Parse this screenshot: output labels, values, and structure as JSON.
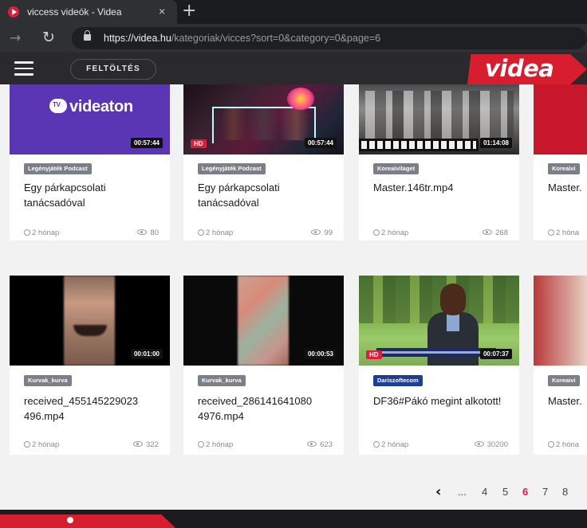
{
  "browser": {
    "tab_title": "viccess videók - Videa",
    "tab_close": "×",
    "new_tab": "+",
    "url_host": "https://videa.hu",
    "url_path": "/kategoriak/vicces?sort=0&category=0&page=6"
  },
  "header": {
    "upload_label": "FELTÖLTÉS",
    "logo_text": "videa"
  },
  "row1": [
    {
      "thumb_text": "videaton",
      "duration": "00:57:44",
      "hd": "",
      "badge": "Legényjáték Podcast",
      "title": "Egy párkapcsolati tanácsadóval",
      "age": "2 hónap",
      "views": "80"
    },
    {
      "thumb_text": "",
      "duration": "00:57:44",
      "hd": "HD",
      "badge": "Legényjáték Podcast",
      "title": "Egy párkapcsolati tanácsadóval",
      "age": "2 hónap",
      "views": "99"
    },
    {
      "thumb_text": "",
      "duration": "01:14:08",
      "hd": "",
      "badge": "Koreaivilaget",
      "title": "Master.146tr.mp4",
      "age": "2 hónap",
      "views": "268"
    },
    {
      "thumb_text": "",
      "duration": "",
      "hd": "",
      "badge": "Koreaivi",
      "title": "Master.",
      "age": "2 hóna",
      "views": ""
    }
  ],
  "row2": [
    {
      "duration": "00:01:00",
      "hd": "",
      "badge": "Kurvak_kurva",
      "title": "received_455145229023 496.mp4",
      "age": "2 hónap",
      "views": "322"
    },
    {
      "duration": "00:00:53",
      "hd": "",
      "badge": "Kurvak_kurva",
      "title": "received_286141641080 4976.mp4",
      "age": "2 hónap",
      "views": "623"
    },
    {
      "duration": "00:07:37",
      "hd": "HD",
      "badge": "Dariszoftecom",
      "title": "DF36#Pákó megint alkotott!",
      "age": "2 hónap",
      "views": "30200"
    },
    {
      "duration": "",
      "hd": "",
      "badge": "Koreaivi",
      "title": "Master.",
      "age": "2 hóna",
      "views": ""
    }
  ],
  "pagination": {
    "prev": "‹",
    "ellipsis": "...",
    "pages": [
      "4",
      "5",
      "6",
      "7",
      "8"
    ],
    "active": "6"
  },
  "colors": {
    "brand_red": "#d71d2e",
    "badge_blue": "#1d3f93",
    "badge_gray": "#7b7f86"
  }
}
